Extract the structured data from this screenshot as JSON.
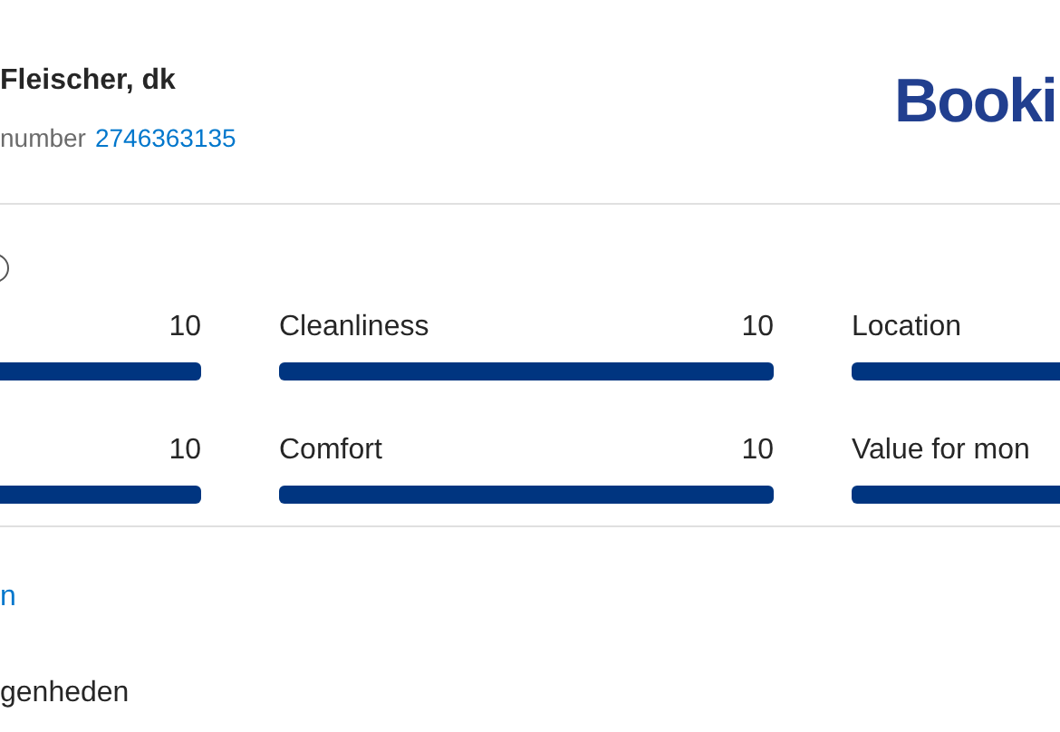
{
  "header": {
    "name": "Fleischer, dk",
    "number_label": "number",
    "number": "2746363135",
    "logo": "Booki"
  },
  "scores": [
    {
      "score": "10",
      "level": 1
    },
    {
      "label": "Cleanliness",
      "score": "10",
      "level": 1
    },
    {
      "label": "Location"
    },
    {
      "score": "10",
      "level": 1
    },
    {
      "label": "Comfort",
      "score": "10",
      "level": 1
    },
    {
      "label": "Value for mon"
    }
  ],
  "link": "n",
  "section_label": "genheden"
}
